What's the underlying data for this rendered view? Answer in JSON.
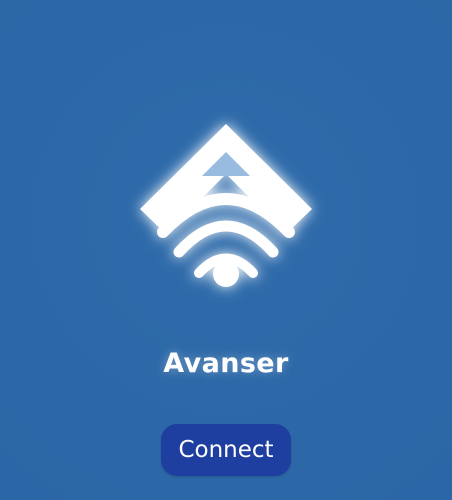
{
  "app": {
    "name": "Avanser",
    "logo_icon": "avanser-wifi-diamond-icon"
  },
  "actions": {
    "connect_label": "Connect"
  },
  "colors": {
    "background": "#2d6aa9",
    "button": "#1e3fa0",
    "logo": "#ffffff",
    "logo_inner": "#98bbe0",
    "text": "#ffffff"
  }
}
